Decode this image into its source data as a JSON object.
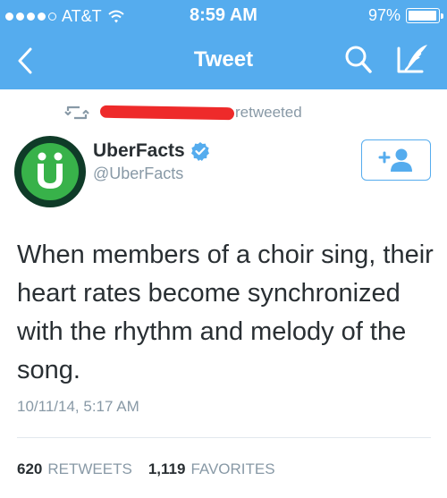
{
  "status_bar": {
    "carrier": "AT&T",
    "time": "8:59 AM",
    "battery": "97%",
    "battery_level": 0.97,
    "signal_bars": 4
  },
  "nav": {
    "title": "Tweet",
    "back_icon": "chevron-left-icon",
    "search_icon": "search-icon",
    "compose_icon": "compose-icon"
  },
  "retweet": {
    "icon": "retweet-icon",
    "label": "retweeted"
  },
  "author": {
    "name": "UberFacts",
    "handle": "@UberFacts",
    "avatar_letter": "Ü",
    "verified": true
  },
  "follow_button": {
    "icon": "follow-user-icon",
    "label": "+"
  },
  "tweet": {
    "text": "When members of a choir sing, their heart rates become synchronized with the rhythm and melody of the song.",
    "timestamp": "10/11/14, 5:17 AM"
  },
  "stats": {
    "retweets_count": "620",
    "retweets_label": "RETWEETS",
    "favorites_count": "1,119",
    "favorites_label": "FAVORITES"
  },
  "colors": {
    "brand": "#55acee",
    "text": "#292f33",
    "muted": "#8899a6",
    "redaction": "#ee2a2a",
    "avatar_green": "#38b24a"
  }
}
